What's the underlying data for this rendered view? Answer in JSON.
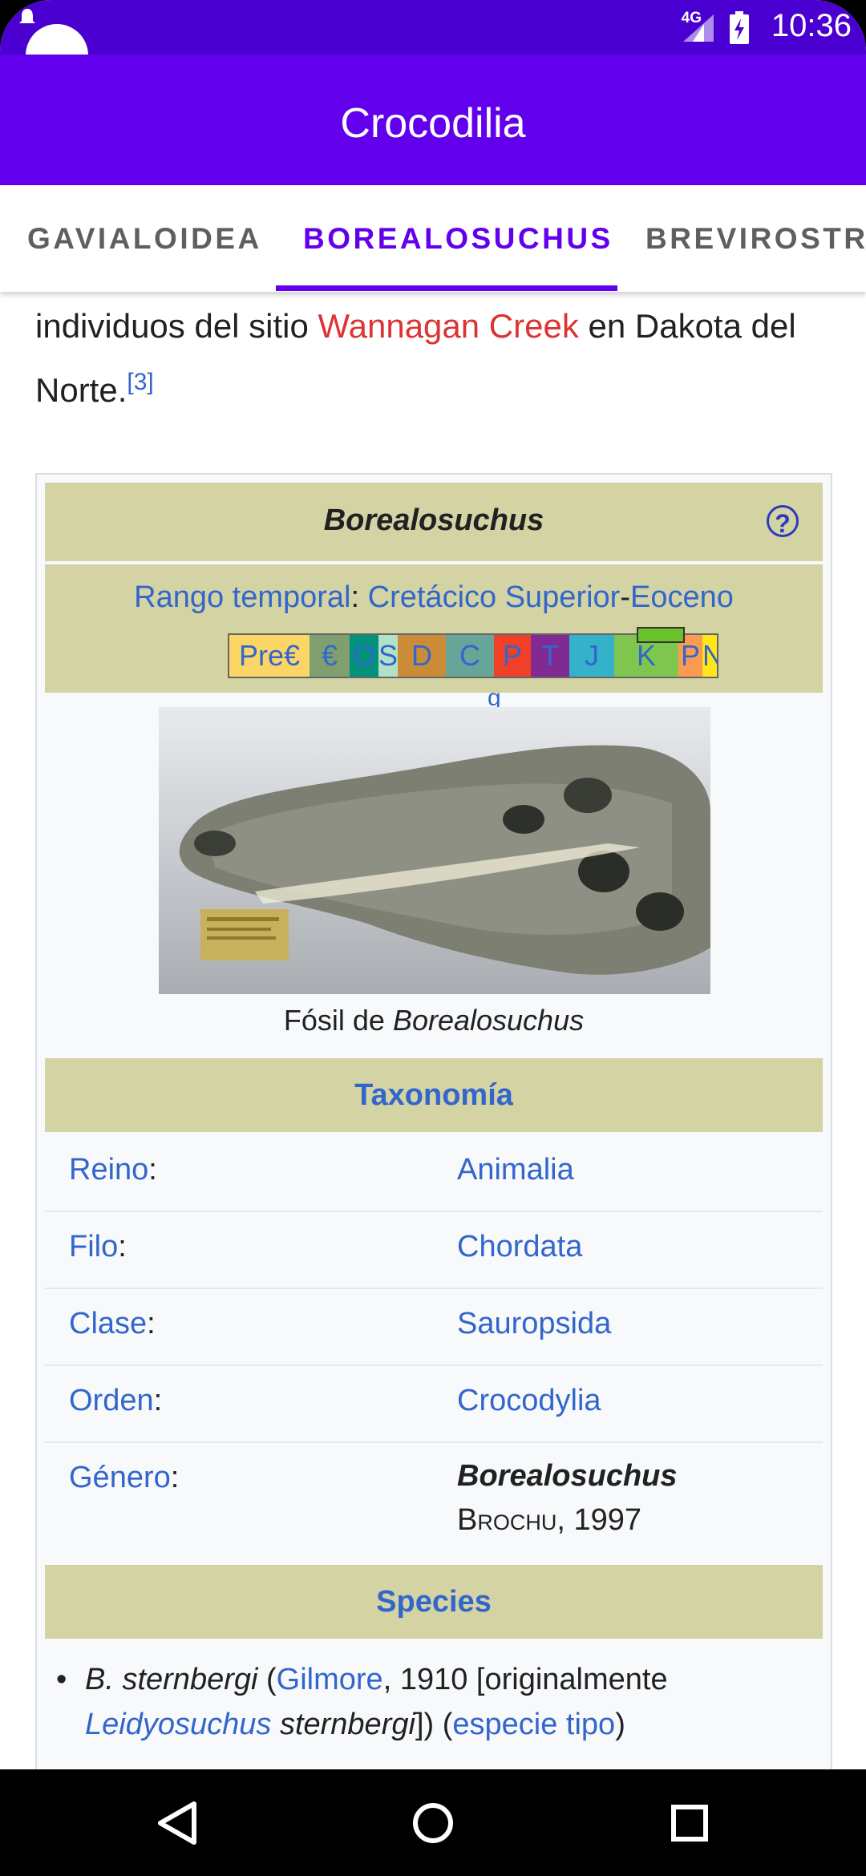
{
  "status": {
    "network": "4G",
    "time": "10:36"
  },
  "app": {
    "title": "Crocodilia"
  },
  "tabs": [
    {
      "label": "GAVIALOIDEA"
    },
    {
      "label": "BOREALOSUCHUS"
    },
    {
      "label": "BREVIROSTRES"
    }
  ],
  "article": {
    "intro_before": "individuos del sitio ",
    "intro_link": "Wannagan Creek",
    "intro_after": " en Dakota del Norte.",
    "ref": "[3]"
  },
  "infobox": {
    "title": "Borealosuchus",
    "help_icon": "?",
    "range_label": "Rango temporal",
    "range_colon": ": ",
    "range_start": "Cretácico Superior",
    "range_dash": "-",
    "range_end": "Eoceno",
    "periods": [
      "Pre€",
      "€",
      "O",
      "S",
      "D",
      "C",
      "P",
      "T",
      "J",
      "K",
      "P",
      "N"
    ],
    "periods_extra": "g",
    "caption_prefix": "Fósil de ",
    "caption_italic": "Borealosuchus",
    "taxonomy_header": "Taxonomía",
    "taxonomy": [
      {
        "key": "Reino",
        "value": "Animalia"
      },
      {
        "key": "Filo",
        "value": "Chordata"
      },
      {
        "key": "Clase",
        "value": "Sauropsida"
      },
      {
        "key": "Orden",
        "value": "Crocodylia"
      },
      {
        "key": "Género",
        "value": "Borealosuchus"
      }
    ],
    "genus_author": "Brochu",
    "genus_year": ", 1997",
    "species_header": "Species",
    "species": {
      "name": "B. sternbergi",
      "open": " (",
      "author_link": "Gilmore",
      "text1": ", 1910 [originalmente ",
      "orig_genus_link": "Leidyosuchus",
      "orig_epithet": " sternbergi",
      "text2": "]) (",
      "type_link": "especie tipo",
      "close": ")"
    }
  },
  "navbar": {
    "back": "back-icon",
    "home": "home-icon",
    "recents": "recents-icon"
  }
}
